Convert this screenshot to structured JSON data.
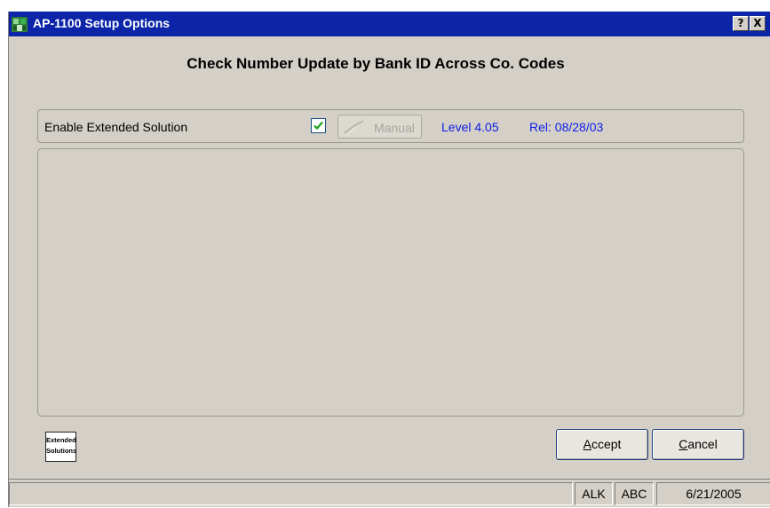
{
  "window": {
    "title": "AP-1100 Setup Options",
    "help_button": "?",
    "close_button": "X"
  },
  "heading": "Check Number Update by Bank ID Across Co. Codes",
  "options": {
    "enable_label": "Enable Extended Solution",
    "enable_checked": true,
    "manual_button": "Manual",
    "level": "Level 4.05",
    "release": "Rel: 08/28/03"
  },
  "logo": {
    "line1": "Extended",
    "line2": "Solutions"
  },
  "buttons": {
    "accept": {
      "mnemonic": "A",
      "rest": "ccept"
    },
    "cancel": {
      "mnemonic": "C",
      "rest": "ancel"
    }
  },
  "statusbar": {
    "message": "",
    "user": "ALK",
    "company": "ABC",
    "date": "6/21/2005"
  },
  "colors": {
    "titlebar": "#0b24a8",
    "window_bg": "#d4d0c8",
    "info_text": "#1020e8",
    "checkmark": "#21a121"
  }
}
